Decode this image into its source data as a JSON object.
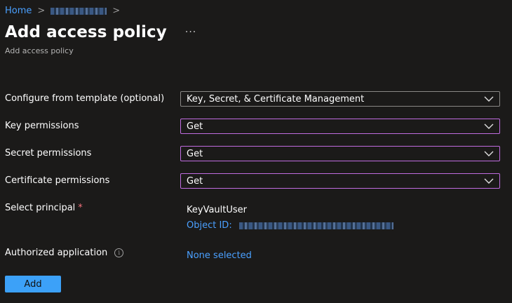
{
  "breadcrumb": {
    "home": "Home",
    "separator": ">"
  },
  "header": {
    "title": "Add access policy",
    "more": "···",
    "subtitle": "Add access policy"
  },
  "form": {
    "template": {
      "label": "Configure from template (optional)",
      "value": "Key, Secret, & Certificate Management"
    },
    "key": {
      "label": "Key permissions",
      "value": "Get"
    },
    "secret": {
      "label": "Secret permissions",
      "value": "Get"
    },
    "certificate": {
      "label": "Certificate permissions",
      "value": "Get"
    },
    "principal": {
      "label": "Select principal",
      "required": "*",
      "name": "KeyVaultUser",
      "object_id_label": "Object ID:"
    },
    "app": {
      "label": "Authorized application",
      "info": "i",
      "value": "None selected"
    }
  },
  "actions": {
    "add": "Add"
  },
  "colors": {
    "accent": "#3ca1f8",
    "link": "#4aa0ff",
    "multiselect_border": "#c06ce0",
    "required": "#f1707b"
  }
}
